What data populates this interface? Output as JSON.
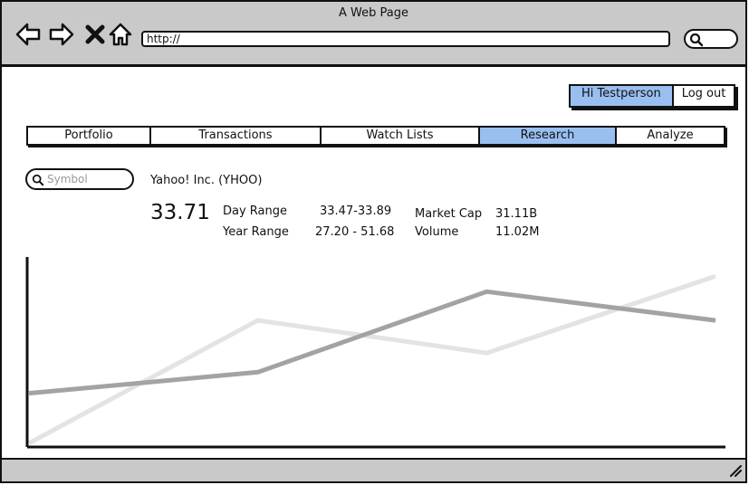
{
  "browser": {
    "title": "A Web Page",
    "url": "http://",
    "colors": {
      "chrome": "#c9c9c9",
      "accent": "#99bff0"
    },
    "icons": [
      "back-arrow-icon",
      "forward-arrow-icon",
      "close-icon",
      "home-icon",
      "search-icon"
    ]
  },
  "header": {
    "greeting": "Hi Testperson",
    "logout_label": "Log out"
  },
  "tabs": [
    {
      "label": "Portfolio",
      "active": false
    },
    {
      "label": "Transactions",
      "active": false
    },
    {
      "label": "Watch Lists",
      "active": false
    },
    {
      "label": "Research",
      "active": true
    },
    {
      "label": "Analyze",
      "active": false
    }
  ],
  "search": {
    "placeholder": "Symbol"
  },
  "quote": {
    "company": "Yahoo! Inc. (YHOO)",
    "price": "33.71",
    "day_range_label": "Day Range",
    "day_range_value": "33.47-33.89",
    "year_range_label": "Year Range",
    "year_range_value": "27.20 - 51.68",
    "market_cap_label": "Market Cap",
    "market_cap_value": "31.11B",
    "volume_label": "Volume",
    "volume_value": "11.02M"
  },
  "chart_data": {
    "type": "line",
    "x": [
      0,
      1,
      2,
      3
    ],
    "ylim": [
      0,
      100
    ],
    "series": [
      {
        "values": [
          28,
          39,
          81,
          66
        ],
        "color": "#a3a3a3"
      },
      {
        "values": [
          2,
          66,
          49,
          89
        ],
        "color": "#e3e3e3"
      }
    ]
  }
}
